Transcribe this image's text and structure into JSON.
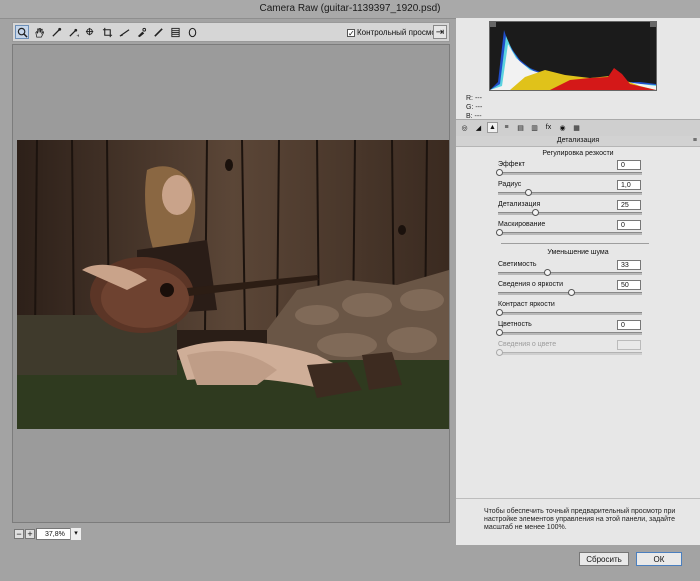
{
  "window": {
    "title": "Camera Raw (guitar-1139397_1920.psd)"
  },
  "toolbar": {
    "tools": [
      "zoom-icon",
      "hand-icon",
      "white-balance-icon",
      "color-sampler-icon",
      "targeted-adjustment-icon",
      "crop-icon",
      "straighten-icon",
      "spot-removal-icon",
      "red-eye-icon",
      "brush-icon",
      "graduated-filter-icon",
      "radial-filter-icon"
    ],
    "preview_label": "Контрольный просмотр",
    "preview_checked": true
  },
  "zoom": {
    "value": "37,8%"
  },
  "histogram": {
    "r": "R:  ---",
    "g": "G:  ---",
    "b": "B:  ---"
  },
  "panel": {
    "title": "Детализация",
    "sharpening": {
      "title": "Регулировка резкости",
      "sliders": [
        {
          "label": "Эффект",
          "value": "0",
          "fraction": 0.0
        },
        {
          "label": "Радиус",
          "value": "1,0",
          "fraction": 0.2
        },
        {
          "label": "Детализация",
          "value": "25",
          "fraction": 0.25
        },
        {
          "label": "Маскирование",
          "value": "0",
          "fraction": 0.0
        }
      ]
    },
    "noise": {
      "title": "Уменьшение шума",
      "sliders": [
        {
          "label": "Светимость",
          "value": "33",
          "fraction": 0.33
        },
        {
          "label": "Сведения о яркости",
          "value": "50",
          "fraction": 0.5
        },
        {
          "label": "Контраст яркости",
          "value": "0",
          "fraction": 0.0
        },
        {
          "label": "Цветность",
          "value": "0",
          "fraction": 0.0
        },
        {
          "label": "Сведения о цвете",
          "value": "",
          "fraction": 0.0,
          "disabled": true
        }
      ]
    },
    "note": "Чтобы обеспечить точный предварительный просмотр при настройке элементов управления на этой панели, задайте масштаб не менее 100%."
  },
  "buttons": {
    "reset": "Сбросить",
    "ok": "ОК"
  },
  "colors": {
    "accent": "#4a7fbf",
    "window_bg": "#a3a3a3",
    "panel_bg": "#e7e7e7"
  }
}
